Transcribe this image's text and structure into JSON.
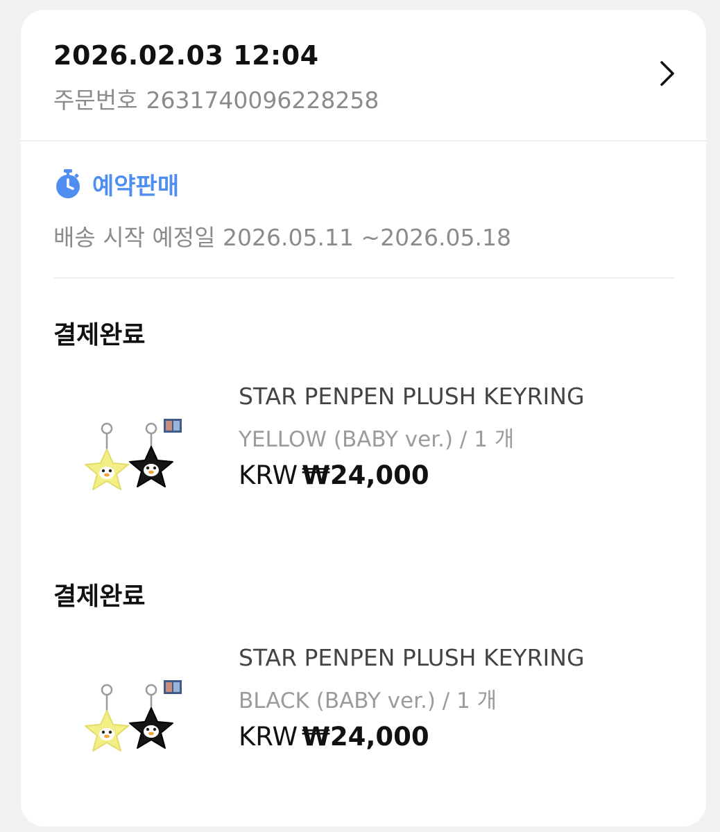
{
  "order": {
    "datetime": "2026.02.03 12:04",
    "number_label": "주문번호",
    "number": "2631740096228258"
  },
  "presale": {
    "label": "예약판매",
    "icon": "stopwatch-icon",
    "shipping_text": "배송 시작 예정일 2026.05.11 ~2026.05.18"
  },
  "items": [
    {
      "status": "결제완료",
      "name": "STAR PENPEN PLUSH KEYRING",
      "option": "YELLOW (BABY ver.) / 1 개",
      "currency": "KRW",
      "price": "₩24,000"
    },
    {
      "status": "결제완료",
      "name": "STAR PENPEN PLUSH KEYRING",
      "option": "BLACK (BABY ver.) / 1 개",
      "currency": "KRW",
      "price": "₩24,000"
    }
  ],
  "colors": {
    "accent": "#4f8ef0",
    "muted_text": "#8b8b8b",
    "background": "#f2f2f4"
  }
}
